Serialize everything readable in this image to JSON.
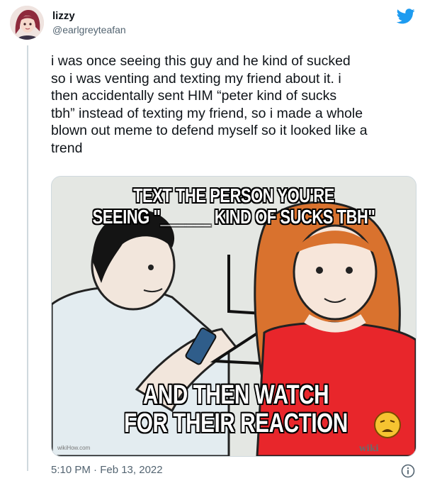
{
  "user": {
    "name": "lizzy",
    "handle": "@earlgreyteafan"
  },
  "tweet": {
    "text": "i was once seeing this guy and he kind of sucked\nso i was venting and texting my friend about it. i\nthen accidentally sent HIM “peter kind of sucks\ntbh” instead of texting my friend, so i made a whole\nblown out meme to defend myself so it looked like a\ntrend",
    "timestamp": "5:10 PM · Feb 13, 2022"
  },
  "meme": {
    "top_line1": "TEXT THE PERSON YOU'RE",
    "top_line2": "SEEING \"______ KIND OF SUCKS TBH\"",
    "bottom_line1": "AND THEN WATCH",
    "bottom_line2": "FOR THEIR REACTION",
    "watermark_left": "wikiHow.com",
    "watermark_right": "wiki"
  },
  "icons": {
    "brand": "twitter-bird-icon",
    "info": "info-icon",
    "emoji": "weary-face-emoji"
  },
  "colors": {
    "brand_blue": "#1d9bf0",
    "secondary_text": "#536471",
    "shirt_red": "#e8262b"
  }
}
